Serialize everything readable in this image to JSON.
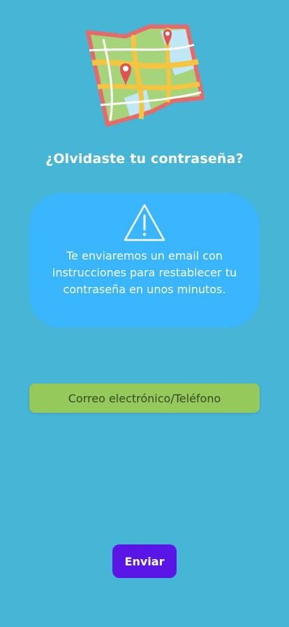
{
  "header": {
    "title": "¿Olvidaste tu contraseña?"
  },
  "illustration": {
    "icon": "map-icon"
  },
  "info_card": {
    "icon": "warning-icon",
    "message": "Te enviaremos un email con instrucciones para restablecer tu contraseña en unos minutos."
  },
  "form": {
    "contact_placeholder": "Correo electrónico/Teléfono",
    "contact_value": ""
  },
  "actions": {
    "send_label": "Enviar"
  },
  "colors": {
    "background": "#47b5d6",
    "card": "#39b6ff",
    "input": "#95c95c",
    "button": "#5a16e6",
    "map_border": "#e66a6a",
    "pin": "#e05252"
  }
}
